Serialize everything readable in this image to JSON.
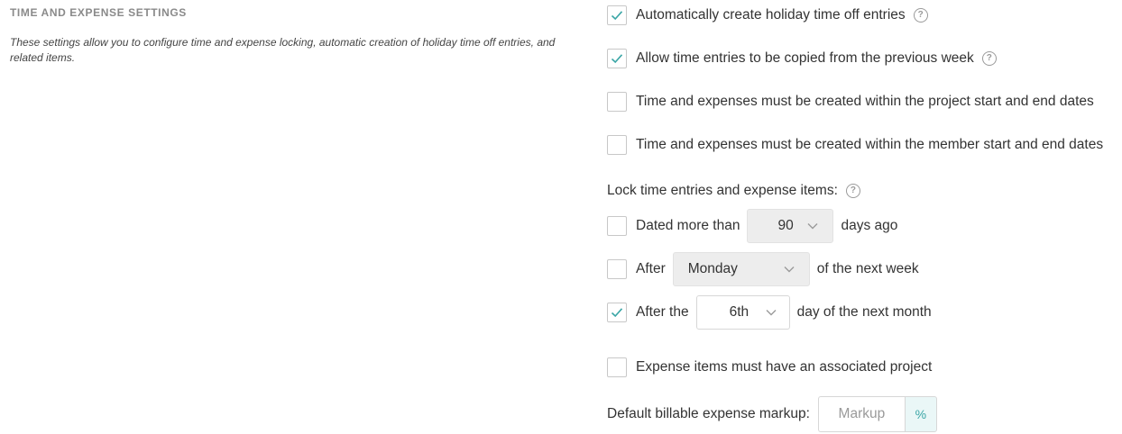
{
  "section": {
    "title": "TIME AND EXPENSE SETTINGS",
    "description": "These settings allow you to configure time and expense locking, automatic creation of holiday time off entries, and related items."
  },
  "options": {
    "holiday": {
      "label": "Automatically create holiday time off entries",
      "checked": true
    },
    "copy_previous": {
      "label": "Allow time entries to be copied from the previous week",
      "checked": true
    },
    "project_dates": {
      "label": "Time and expenses must be created within the project start and end dates",
      "checked": false
    },
    "member_dates": {
      "label": "Time and expenses must be created within the member start and end dates",
      "checked": false
    }
  },
  "lock": {
    "heading": "Lock time entries and expense items:",
    "dated": {
      "prefix": "Dated more than",
      "value": "90",
      "suffix": "days ago",
      "checked": false
    },
    "after_day": {
      "prefix": "After",
      "value": "Monday",
      "suffix": "of the next week",
      "checked": false
    },
    "after_month": {
      "prefix": "After the",
      "value": "6th",
      "suffix": "day of the next month",
      "checked": true
    }
  },
  "expense_project": {
    "label": "Expense items must have an associated project",
    "checked": false
  },
  "markup": {
    "label": "Default billable expense markup:",
    "placeholder": "Markup",
    "value": "",
    "unit": "%"
  },
  "colors": {
    "check": "#3aa6a6",
    "addon_bg": "#eaf7f7"
  },
  "icons": {
    "help": "question-circle-icon",
    "check": "checkmark-icon",
    "chevron": "chevron-down-icon"
  }
}
